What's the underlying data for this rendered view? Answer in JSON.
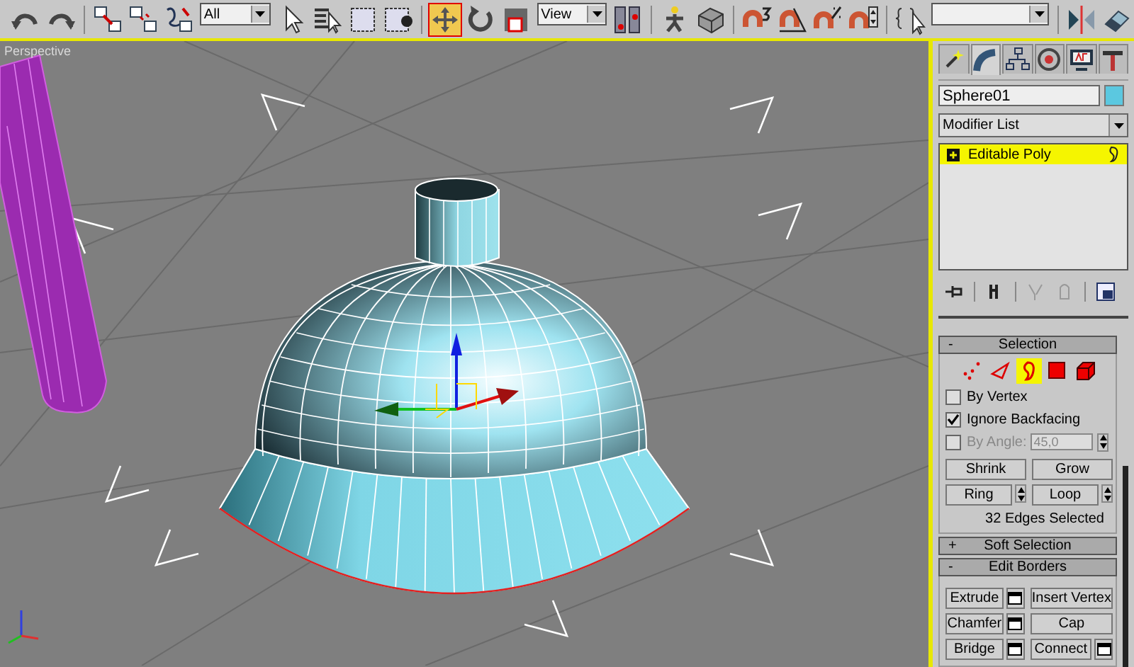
{
  "toolbar": {
    "items": [
      {
        "kind": "button",
        "selected": false
      },
      {
        "kind": "button",
        "selected": false
      },
      {
        "kind": "separator"
      },
      {
        "kind": "button",
        "selected": false
      },
      {
        "kind": "button",
        "selected": false
      },
      {
        "kind": "button",
        "selected": false
      },
      {
        "kind": "dropdown",
        "value": "All"
      },
      {
        "kind": "button",
        "selected": false
      },
      {
        "kind": "button",
        "selected": false
      },
      {
        "kind": "button",
        "selected": false
      },
      {
        "kind": "button",
        "selected": false
      },
      {
        "kind": "separator"
      },
      {
        "kind": "button",
        "selected": true
      },
      {
        "kind": "button",
        "selected": false
      },
      {
        "kind": "button",
        "selected": false
      },
      {
        "kind": "dropdown",
        "value": "View"
      },
      {
        "kind": "button",
        "selected": false
      },
      {
        "kind": "separator"
      },
      {
        "kind": "button",
        "selected": false
      },
      {
        "kind": "button",
        "selected": false
      },
      {
        "kind": "separator"
      },
      {
        "kind": "button",
        "selected": false
      },
      {
        "kind": "button",
        "selected": false
      },
      {
        "kind": "button",
        "selected": false
      },
      {
        "kind": "button",
        "selected": false
      },
      {
        "kind": "separator"
      },
      {
        "kind": "button",
        "selected": false
      },
      {
        "kind": "dropdown",
        "value": ""
      },
      {
        "kind": "separator"
      },
      {
        "kind": "button",
        "selected": false
      },
      {
        "kind": "button",
        "selected": false
      }
    ]
  },
  "viewport": {
    "label": "Perspective"
  },
  "command_panel": {
    "tabs": [
      {
        "selected": false
      },
      {
        "selected": true
      },
      {
        "selected": false
      },
      {
        "selected": false
      },
      {
        "selected": false
      },
      {
        "selected": false
      }
    ],
    "object_name": "Sphere01",
    "modifier_list": "Modifier List",
    "stack": [
      {
        "label": "Editable Poly"
      }
    ],
    "rollouts": [
      {
        "kind": "selection",
        "title": "Selection",
        "sign": "-",
        "expanded": true,
        "levels": [
          {
            "selected": false
          },
          {
            "selected": false
          },
          {
            "selected": true
          },
          {
            "selected": false
          },
          {
            "selected": false
          }
        ],
        "options": [
          {
            "label": "By Vertex",
            "checked": false,
            "disabled": false
          },
          {
            "label": "Ignore Backfacing",
            "checked": true,
            "disabled": false
          },
          {
            "label": "By Angle:",
            "checked": false,
            "disabled": true,
            "value": "45,0"
          }
        ],
        "buttons": [
          {
            "label": "Shrink",
            "spinner": false
          },
          {
            "label": "Grow",
            "spinner": false
          },
          {
            "label": "Ring",
            "spinner": true
          },
          {
            "label": "Loop",
            "spinner": true
          }
        ],
        "status": "32 Edges Selected"
      },
      {
        "kind": "plain",
        "title": "Soft Selection",
        "sign": "+",
        "expanded": false
      },
      {
        "kind": "buttons",
        "title": "Edit Borders",
        "sign": "-",
        "expanded": true,
        "buttons": [
          {
            "label": "Extrude",
            "settings": true
          },
          {
            "label": "Insert Vertex",
            "settings": false
          },
          {
            "label": "Chamfer",
            "settings": true
          },
          {
            "label": "Cap",
            "settings": false
          },
          {
            "label": "Bridge",
            "settings": true
          },
          {
            "label": "Connect",
            "settings": true
          }
        ]
      }
    ]
  }
}
